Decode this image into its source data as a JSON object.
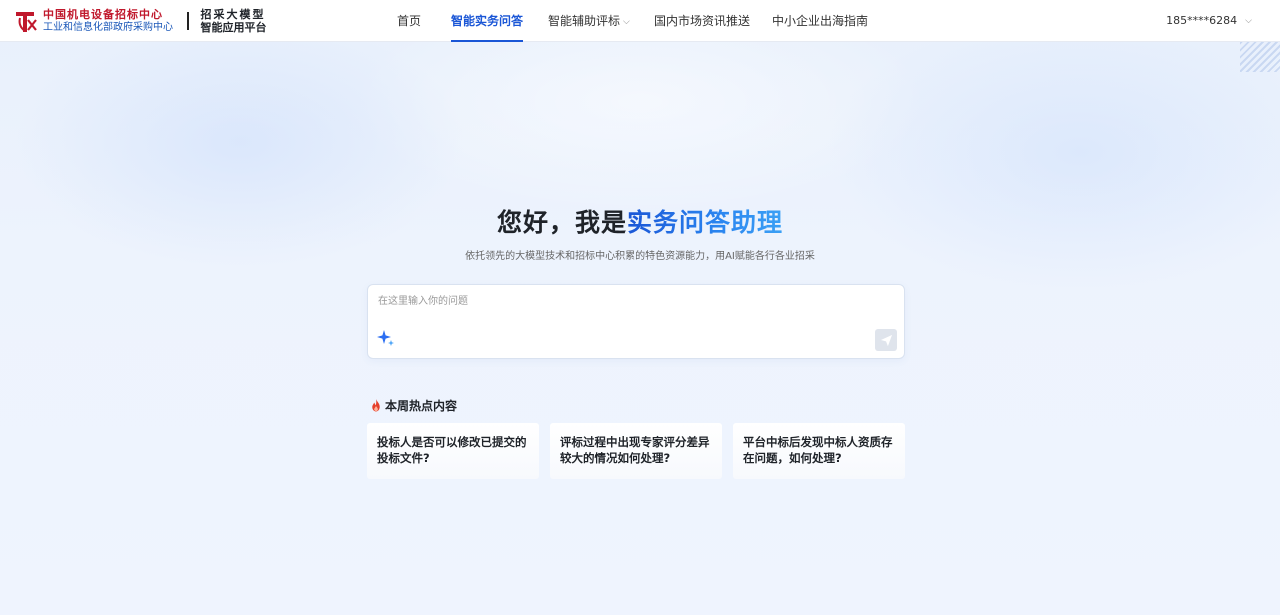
{
  "header": {
    "org_line1": "中国机电设备招标中心",
    "org_line2": "工业和信息化部政府采购中心",
    "platform_line1": "招采大模型",
    "platform_line2": "智能应用平台",
    "nav": [
      {
        "label": "首页",
        "active": false
      },
      {
        "label": "智能实务问答",
        "active": true
      },
      {
        "label": "智能辅助评标",
        "active": false,
        "has_dropdown": true
      },
      {
        "label": "国内市场资讯推送",
        "active": false
      },
      {
        "label": "中小企业出海指南",
        "active": false
      }
    ],
    "user": "185****6284"
  },
  "hero": {
    "title_prefix": "您好，我是",
    "title_highlight": "实务问答助理",
    "subtitle": "依托领先的大模型技术和招标中心积累的特色资源能力，用AI赋能各行各业招采"
  },
  "ask": {
    "placeholder": "在这里输入你的问题",
    "value": ""
  },
  "hot": {
    "title": "本周热点内容",
    "items": [
      "投标人是否可以修改已提交的投标文件?",
      "评标过程中出现专家评分差异较大的情况如何处理?",
      "平台中标后发现中标人资质存在问题，如何处理?"
    ]
  },
  "colors": {
    "accent": "#1a56d6",
    "brand_red": "#c0182c",
    "brand_blue": "#1a57b8"
  }
}
